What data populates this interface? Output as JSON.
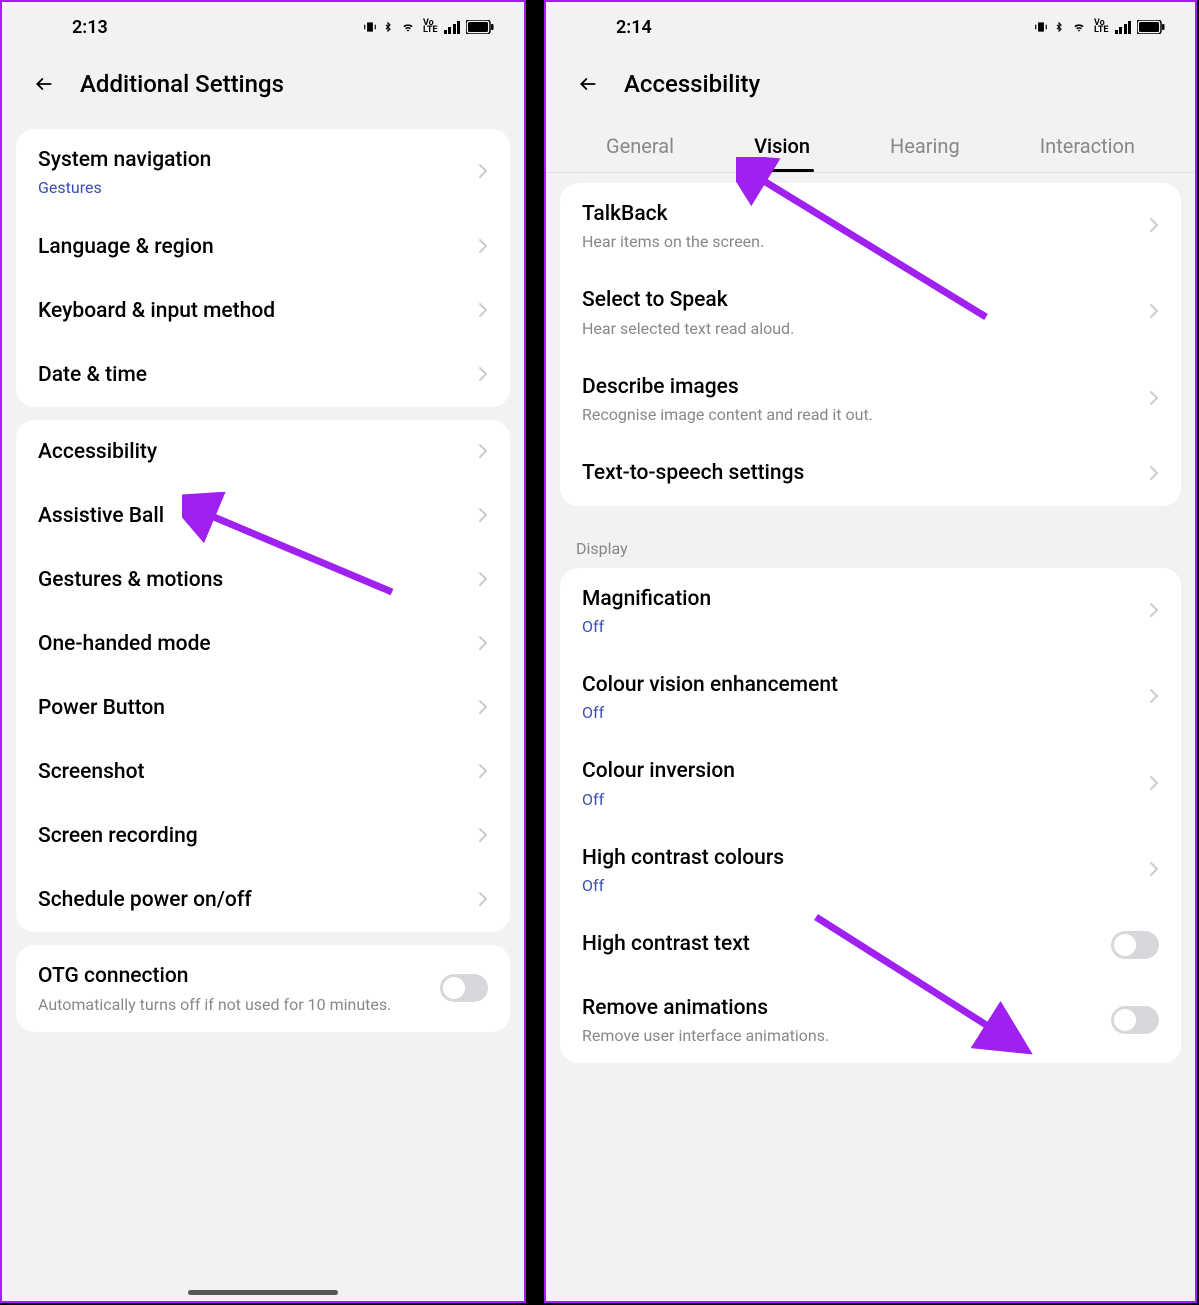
{
  "left": {
    "status_time": "2:13",
    "header_title": "Additional Settings",
    "group1": [
      {
        "title": "System navigation",
        "sub": "Gestures",
        "sub_blue": true
      },
      {
        "title": "Language & region"
      },
      {
        "title": "Keyboard & input method"
      },
      {
        "title": "Date & time"
      }
    ],
    "group2": [
      {
        "title": "Accessibility"
      },
      {
        "title": "Assistive Ball"
      },
      {
        "title": "Gestures & motions"
      },
      {
        "title": "One-handed mode"
      },
      {
        "title": "Power Button"
      },
      {
        "title": "Screenshot"
      },
      {
        "title": "Screen recording"
      },
      {
        "title": "Schedule power on/off"
      }
    ],
    "group3": [
      {
        "title": "OTG connection",
        "sub": "Automatically turns off if not used for 10 minutes.",
        "toggle": true
      }
    ]
  },
  "right": {
    "status_time": "2:14",
    "header_title": "Accessibility",
    "tabs": [
      "General",
      "Vision",
      "Hearing",
      "Interaction"
    ],
    "active_tab": "Vision",
    "group1": [
      {
        "title": "TalkBack",
        "sub": "Hear items on the screen."
      },
      {
        "title": "Select to Speak",
        "sub": "Hear selected text read aloud."
      },
      {
        "title": "Describe images",
        "sub": "Recognise image content and read it out."
      },
      {
        "title": "Text-to-speech settings"
      }
    ],
    "section_label": "Display",
    "group2": [
      {
        "title": "Magnification",
        "sub": "Off",
        "sub_blue": true
      },
      {
        "title": "Colour vision enhancement",
        "sub": "Off",
        "sub_blue": true
      },
      {
        "title": "Colour inversion",
        "sub": "Off",
        "sub_blue": true
      },
      {
        "title": "High contrast colours",
        "sub": "Off",
        "sub_blue": true
      },
      {
        "title": "High contrast text",
        "toggle": true
      },
      {
        "title": "Remove animations",
        "sub": "Remove user interface animations.",
        "toggle": true
      }
    ]
  }
}
